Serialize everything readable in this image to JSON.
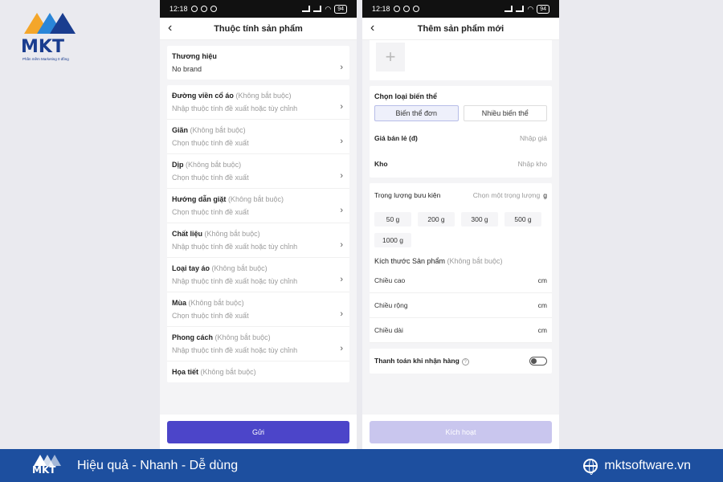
{
  "branding": {
    "logo_word": "MKT",
    "logo_tagline": "Phần mềm Marketing 0 đồng",
    "slogan": "Hiệu quả - Nhanh - Dễ dùng",
    "website": "mktsoftware.vn",
    "colors": {
      "brand_blue": "#1d4f9f",
      "accent_purple": "#4c45c9"
    }
  },
  "statusbar": {
    "time": "12:18",
    "battery": "94"
  },
  "left_screen": {
    "title": "Thuộc tính sản phẩm",
    "brand": {
      "label": "Thương hiệu",
      "value": "No brand"
    },
    "optional_tag": "(Không bắt buộc)",
    "attributes": [
      {
        "label": "Đường viền cổ áo",
        "hint": "Nhập thuộc tính đề xuất hoặc tùy chỉnh"
      },
      {
        "label": "Giãn",
        "hint": "Chọn thuộc tính đề xuất"
      },
      {
        "label": "Dịp",
        "hint": "Chọn thuộc tính đề xuất"
      },
      {
        "label": "Hướng dẫn giặt",
        "hint": "Chọn thuộc tính đề xuất"
      },
      {
        "label": "Chất liệu",
        "hint": "Nhập thuộc tính đề xuất hoặc tùy chỉnh"
      },
      {
        "label": "Loại tay áo",
        "hint": "Nhập thuộc tính đề xuất hoặc tùy chỉnh"
      },
      {
        "label": "Mùa",
        "hint": "Chọn thuộc tính đề xuất"
      },
      {
        "label": "Phong cách",
        "hint": "Nhập thuộc tính đề xuất hoặc tùy chỉnh"
      },
      {
        "label": "Họa tiết",
        "hint": ""
      }
    ],
    "submit_label": "Gửi"
  },
  "right_screen": {
    "title": "Thêm sản phẩm mới",
    "variant_section": "Chọn loại biến thể",
    "variant_single": "Biến thể đơn",
    "variant_multi": "Nhiều biến thể",
    "price_label": "Giá bán lẻ (đ)",
    "price_placeholder": "Nhập giá",
    "stock_label": "Kho",
    "stock_placeholder": "Nhập kho",
    "weight_label": "Trọng lượng bưu kiện",
    "weight_placeholder": "Chọn một trọng lượng",
    "weight_unit": "g",
    "weight_chips": [
      "50 g",
      "200 g",
      "300 g",
      "500 g",
      "1000 g"
    ],
    "size_label": "Kích thước Sản phẩm",
    "size_optional": "(Không bắt buộc)",
    "dimensions": [
      {
        "label": "Chiều cao",
        "unit": "cm"
      },
      {
        "label": "Chiều rộng",
        "unit": "cm"
      },
      {
        "label": "Chiều dài",
        "unit": "cm"
      }
    ],
    "cod_label": "Thanh toán khi nhận hàng",
    "activate_label": "Kích hoạt"
  }
}
